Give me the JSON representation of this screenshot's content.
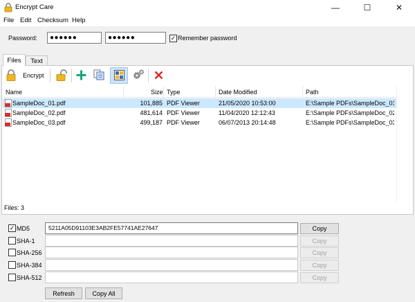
{
  "window": {
    "title": "Encrypt Care",
    "controls": {
      "minimize": "—",
      "maximize": "☐",
      "close": "✕"
    }
  },
  "menu": [
    "File",
    "Edit",
    "Checksum",
    "Help"
  ],
  "password": {
    "label": "Password:",
    "value_masked": "●●●●●●",
    "confirm_masked": "●●●●●●",
    "remember_label": "Remember password",
    "remember_checked": true
  },
  "tabs": [
    {
      "label": "Files",
      "active": true
    },
    {
      "label": "Text",
      "active": false
    }
  ],
  "toolbar": {
    "encrypt_label": "Encrypt",
    "icons": [
      "lock-closed-icon",
      "lock-open-icon",
      "add-icon",
      "copy-files-icon",
      "checksum-icon",
      "settings-icon",
      "remove-icon"
    ],
    "colors": {
      "lock": "#f0b61e",
      "add": "#1aa37a",
      "remove": "#e02323",
      "active_bg": "#cce4f7"
    }
  },
  "table": {
    "columns": [
      "Name",
      "Size",
      "Type",
      "Date Modified",
      "Path"
    ],
    "rows": [
      {
        "name": "SampleDoc_01.pdf",
        "size": "101,885",
        "type": "PDF Viewer",
        "date": "21/05/2020 10:53:00",
        "path": "E:\\Sample PDFs\\SampleDoc_01...",
        "selected": true
      },
      {
        "name": "SampleDoc_02.pdf",
        "size": "481,614",
        "type": "PDF Viewer",
        "date": "11/04/2020 12:12:43",
        "path": "E:\\Sample PDFs\\SampleDoc_02...",
        "selected": false
      },
      {
        "name": "SampleDoc_03.pdf",
        "size": "499,187",
        "type": "PDF Viewer",
        "date": "06/07/2013 20:14:48",
        "path": "E:\\Sample PDFs\\SampleDoc_03...",
        "selected": false
      }
    ],
    "selected_color": "#cce8ff"
  },
  "status": {
    "files_count": "Files: 3"
  },
  "checksums": [
    {
      "label": "MD5",
      "checked": true,
      "value": "5211A05D91103E3AB2FE57741AE27647",
      "copy": "Copy",
      "enabled": true
    },
    {
      "label": "SHA-1",
      "checked": false,
      "value": "",
      "copy": "Copy",
      "enabled": false
    },
    {
      "label": "SHA-256",
      "checked": false,
      "value": "",
      "copy": "Copy",
      "enabled": false
    },
    {
      "label": "SHA-384",
      "checked": false,
      "value": "",
      "copy": "Copy",
      "enabled": false
    },
    {
      "label": "SHA-512",
      "checked": false,
      "value": "",
      "copy": "Copy",
      "enabled": false
    }
  ],
  "buttons": {
    "refresh": "Refresh",
    "copy_all": "Copy All"
  }
}
